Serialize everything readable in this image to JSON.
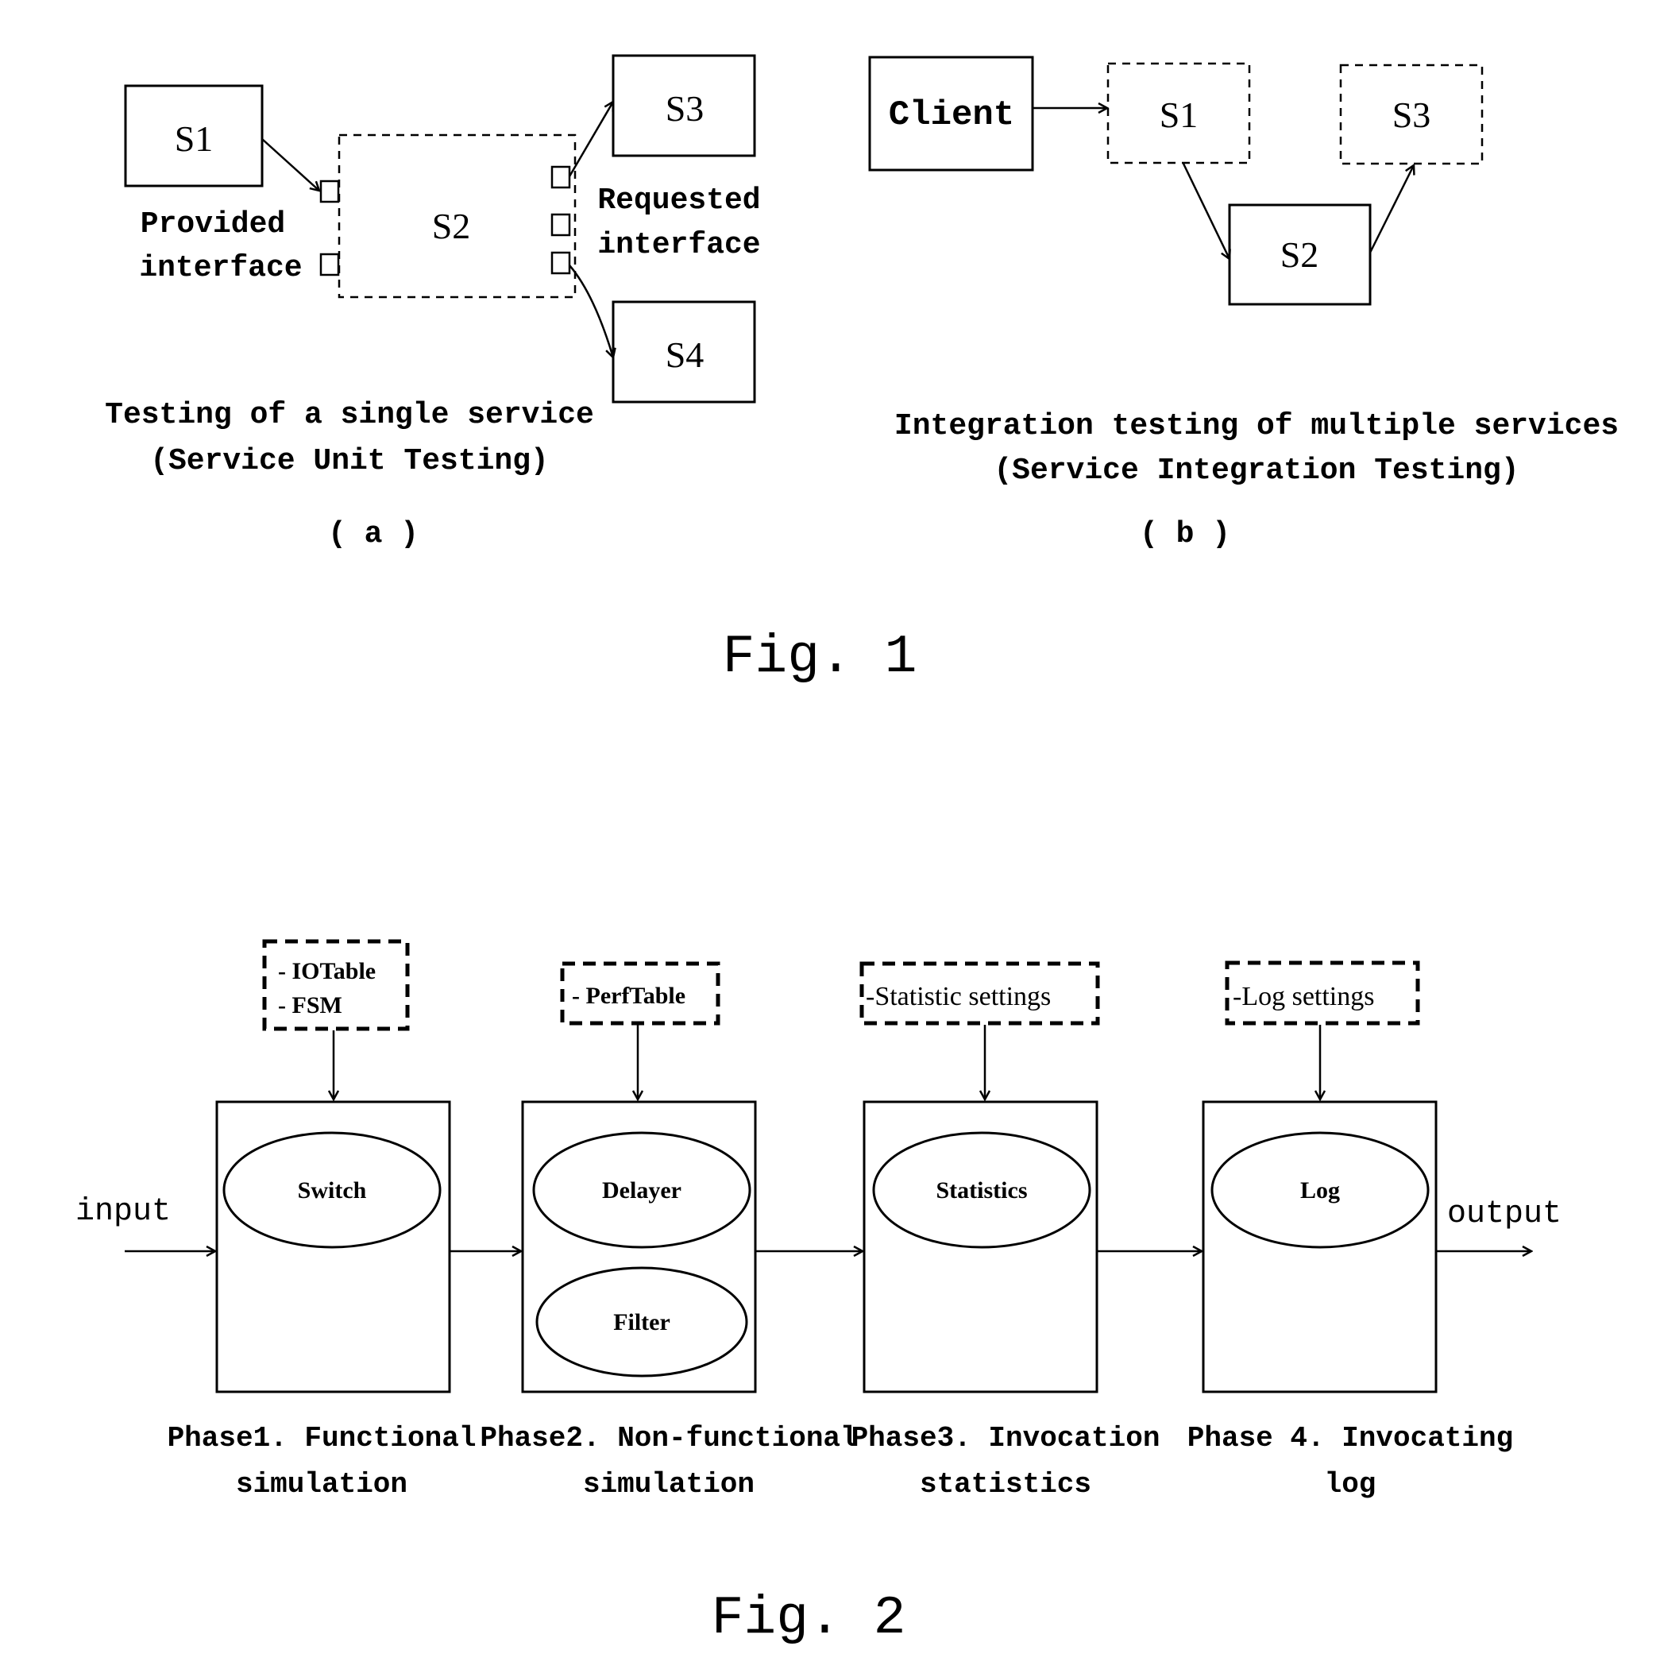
{
  "figure1": {
    "caption": "Fig. 1",
    "panel_a": {
      "label": "( a )",
      "nodes": {
        "s1": "S1",
        "s2": "S2",
        "s3": "S3",
        "s4": "S4"
      },
      "provided_interface": [
        "Provided",
        "interface"
      ],
      "requested_interface": [
        "Requested",
        "interface"
      ],
      "title": [
        "Testing of a single service",
        "(Service Unit Testing)"
      ]
    },
    "panel_b": {
      "label": "( b )",
      "nodes": {
        "client": "Client",
        "s1": "S1",
        "s2": "S2",
        "s3": "S3"
      },
      "title": [
        "Integration testing of multiple services",
        "(Service Integration Testing)"
      ]
    }
  },
  "figure2": {
    "caption": "Fig. 2",
    "input_label": "input",
    "output_label": "output",
    "phases": [
      {
        "settings": [
          "- IOTable",
          "-  FSM"
        ],
        "components": [
          "Switch"
        ],
        "caption": [
          "Phase1. Functional",
          "simulation"
        ]
      },
      {
        "settings": [
          "- PerfTable"
        ],
        "components": [
          "Delayer",
          "Filter"
        ],
        "caption": [
          "Phase2. Non-functional",
          "simulation"
        ]
      },
      {
        "settings": [
          "-Statistic settings"
        ],
        "components": [
          "Statistics"
        ],
        "caption": [
          "Phase3. Invocation",
          "statistics"
        ]
      },
      {
        "settings": [
          "-Log settings"
        ],
        "components": [
          "Log"
        ],
        "caption": [
          "Phase 4. Invocating",
          "log"
        ]
      }
    ]
  }
}
